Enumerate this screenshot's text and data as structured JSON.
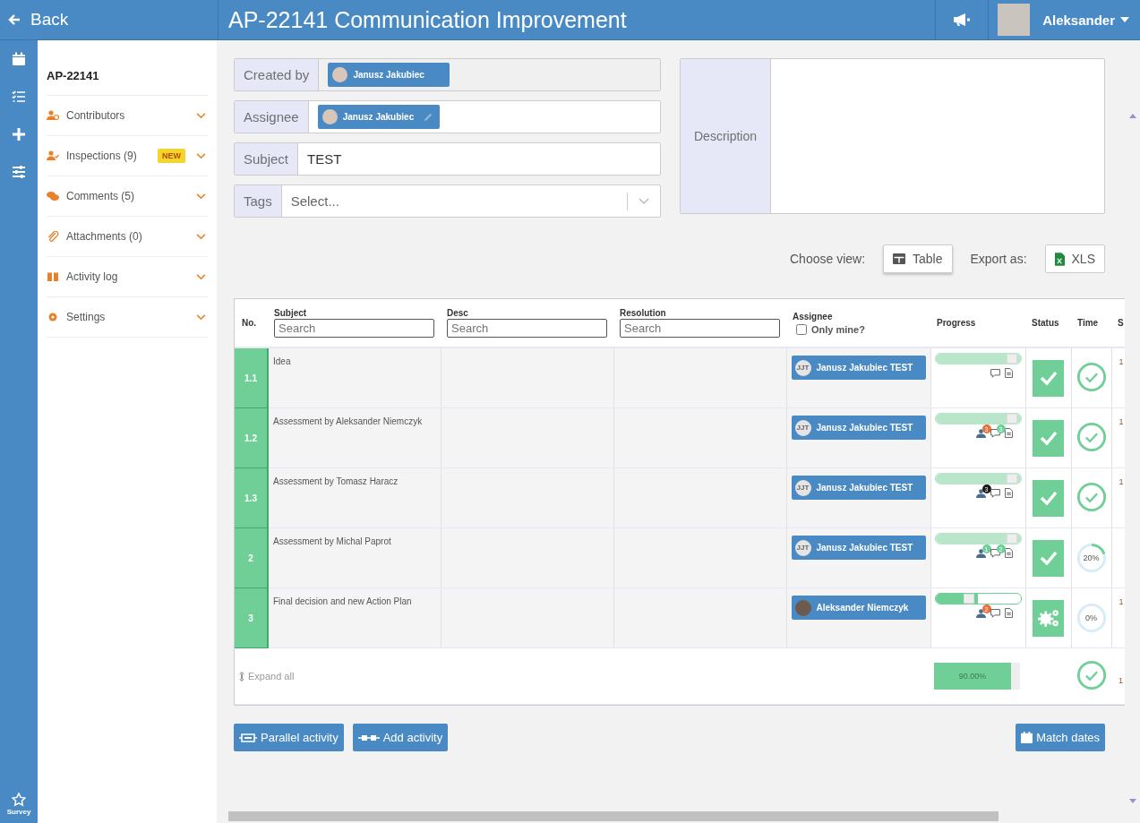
{
  "topbar": {
    "back": "Back",
    "title": "AP-22141 Communication Improvement",
    "user": "Aleksander"
  },
  "rail": {
    "survey": "Survey"
  },
  "sidebar": {
    "id": "AP-22141",
    "items": [
      {
        "label": "Contributors"
      },
      {
        "label": "Inspections (9)",
        "badge": "NEW"
      },
      {
        "label": "Comments (5)"
      },
      {
        "label": "Attachments (0)"
      },
      {
        "label": "Activity log"
      },
      {
        "label": "Settings"
      }
    ]
  },
  "form": {
    "created_by": {
      "label": "Created by",
      "person": "Janusz Jakubiec"
    },
    "assignee": {
      "label": "Assignee",
      "person": "Janusz Jakubiec"
    },
    "subject": {
      "label": "Subject",
      "value": "TEST"
    },
    "tags": {
      "label": "Tags",
      "placeholder": "Select..."
    },
    "description": {
      "label": "Description"
    }
  },
  "view": {
    "label": "Choose view:",
    "button": "Table",
    "export_label": "Export as:",
    "export_button": "XLS"
  },
  "table": {
    "columns": [
      {
        "label": "No."
      },
      {
        "label": "Subject",
        "placeholder": "Search"
      },
      {
        "label": "Desc",
        "placeholder": "Search"
      },
      {
        "label": "Resolution",
        "placeholder": "Search"
      },
      {
        "label": "Assignee",
        "filter": "Only mine?",
        "checked": false
      },
      {
        "label": "Progress"
      },
      {
        "label": "Status"
      },
      {
        "label": "Time"
      },
      {
        "label": "S"
      }
    ],
    "rows": [
      {
        "no": "1.1",
        "subject": "Idea",
        "assignee": {
          "kind": "initials",
          "name": "Janusz Jakubiec TEST",
          "initials": "JJT"
        },
        "progress": {
          "level": 1
        },
        "status": {
          "kind": "done"
        },
        "time": {
          "kind": "done"
        },
        "column_9": "1"
      },
      {
        "no": "1.2",
        "subject": "Assessment by Aleksander Niemczyk",
        "assignee": {
          "kind": "initials",
          "name": "Janusz Jakubiec TEST",
          "initials": "JJT"
        },
        "progress": {
          "level": 1,
          "people": {
            "count": "3",
            "color": "#e8703a"
          },
          "comments": {
            "count": "3",
            "color": "#6fcf97"
          }
        },
        "status": {
          "kind": "done"
        },
        "time": {
          "kind": "done"
        },
        "column_9": "1"
      },
      {
        "no": "1.3",
        "subject": "Assessment by Tomasz Haracz",
        "assignee": {
          "kind": "initials",
          "name": "Janusz Jakubiec TEST",
          "initials": "JJT"
        },
        "progress": {
          "level": 1,
          "people": {
            "count": "3",
            "color": "#1a1a1a"
          }
        },
        "status": {
          "kind": "done"
        },
        "time": {
          "kind": "done"
        },
        "column_9": "1"
      },
      {
        "no": "2",
        "subject": "Assessment by Michal Paprot",
        "assignee": {
          "kind": "initials",
          "name": "Janusz Jakubiec TEST",
          "initials": "JJT"
        },
        "progress": {
          "level": 1,
          "people": {
            "count": "1",
            "color": "#6fcf97"
          },
          "comments": {
            "count": "2",
            "color": "#6fcf97"
          }
        },
        "status": {
          "kind": "done"
        },
        "time": {
          "kind": "percent",
          "text": "20%",
          "level": 0.2
        }
      },
      {
        "no": "3",
        "subject": "Final decision and new Action Plan",
        "assignee": {
          "kind": "photo",
          "name": "Aleksander Niemczyk"
        },
        "progress": {
          "level": 0.5,
          "people": {
            "count": "2",
            "color": "#e8703a"
          }
        },
        "status": {
          "kind": "in_progress"
        },
        "time": {
          "kind": "percent",
          "text": "0%",
          "level": 0
        },
        "column_9": "1"
      }
    ],
    "footer": {
      "expand": "Expand all",
      "total": {
        "text": "90.00%",
        "level": 0.9
      },
      "time": {
        "kind": "done"
      },
      "column_9": "1"
    }
  },
  "buttons": {
    "parallel": "Parallel activity",
    "add": "Add activity",
    "match": "Match dates"
  }
}
